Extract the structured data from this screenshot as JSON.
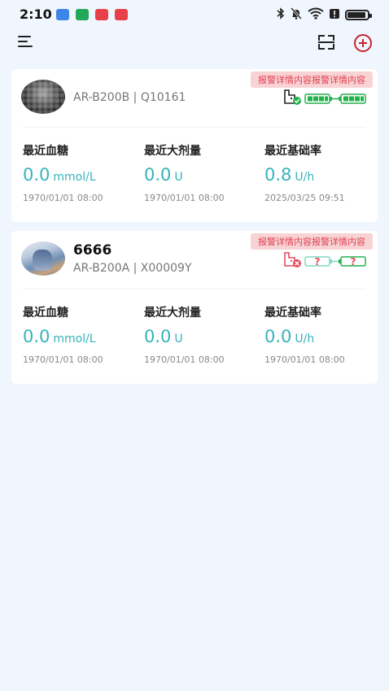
{
  "status_bar": {
    "time": "2:10",
    "notification_icons": [
      "usb-icon",
      "android-icon",
      "app-icon",
      "app-icon"
    ],
    "system_icons": [
      "bluetooth-icon",
      "mute-icon",
      "wifi-icon",
      "alert-icon",
      "battery-icon"
    ],
    "battery_level": 0.9
  },
  "app_bar": {
    "left_icon": "menu-icon",
    "right_icons": [
      "scan-icon",
      "add-circle-icon"
    ]
  },
  "colors": {
    "background": "#f0f6fd",
    "accent_teal": "#36b3ba",
    "alarm_bg": "#f8d3d5",
    "alarm_text": "#e04050",
    "add_red": "#c8242e",
    "connected_green": "#22b14c",
    "disconnected_red": "#e84a5f"
  },
  "devices": [
    {
      "alarm": "报警详情内容报警详情内容",
      "name": "",
      "model": "AR-B200B",
      "serial": "Q10161",
      "device_line": "AR-B200B | Q10161",
      "connection": "connected",
      "pump_battery": 0.9,
      "sensor_battery": 0.9,
      "metrics": [
        {
          "label": "最近血糖",
          "value": "0.0",
          "unit": "mmol/L",
          "time": "1970/01/01 08:00"
        },
        {
          "label": "最近大剂量",
          "value": "0.0",
          "unit": "U",
          "time": "1970/01/01 08:00"
        },
        {
          "label": "最近基础率",
          "value": "0.8",
          "unit": "U/h",
          "time": "2025/03/25 09:51"
        }
      ]
    },
    {
      "alarm": "报警详情内容报警详情内容",
      "name": "6666",
      "model": "AR-B200A",
      "serial": "X00009Y",
      "device_line": "AR-B200A | X00009Y",
      "connection": "disconnected",
      "pump_battery": null,
      "sensor_battery": null,
      "metrics": [
        {
          "label": "最近血糖",
          "value": "0.0",
          "unit": "mmol/L",
          "time": "1970/01/01 08:00"
        },
        {
          "label": "最近大剂量",
          "value": "0.0",
          "unit": "U",
          "time": "1970/01/01 08:00"
        },
        {
          "label": "最近基础率",
          "value": "0.0",
          "unit": "U/h",
          "time": "1970/01/01 08:00"
        }
      ]
    }
  ]
}
